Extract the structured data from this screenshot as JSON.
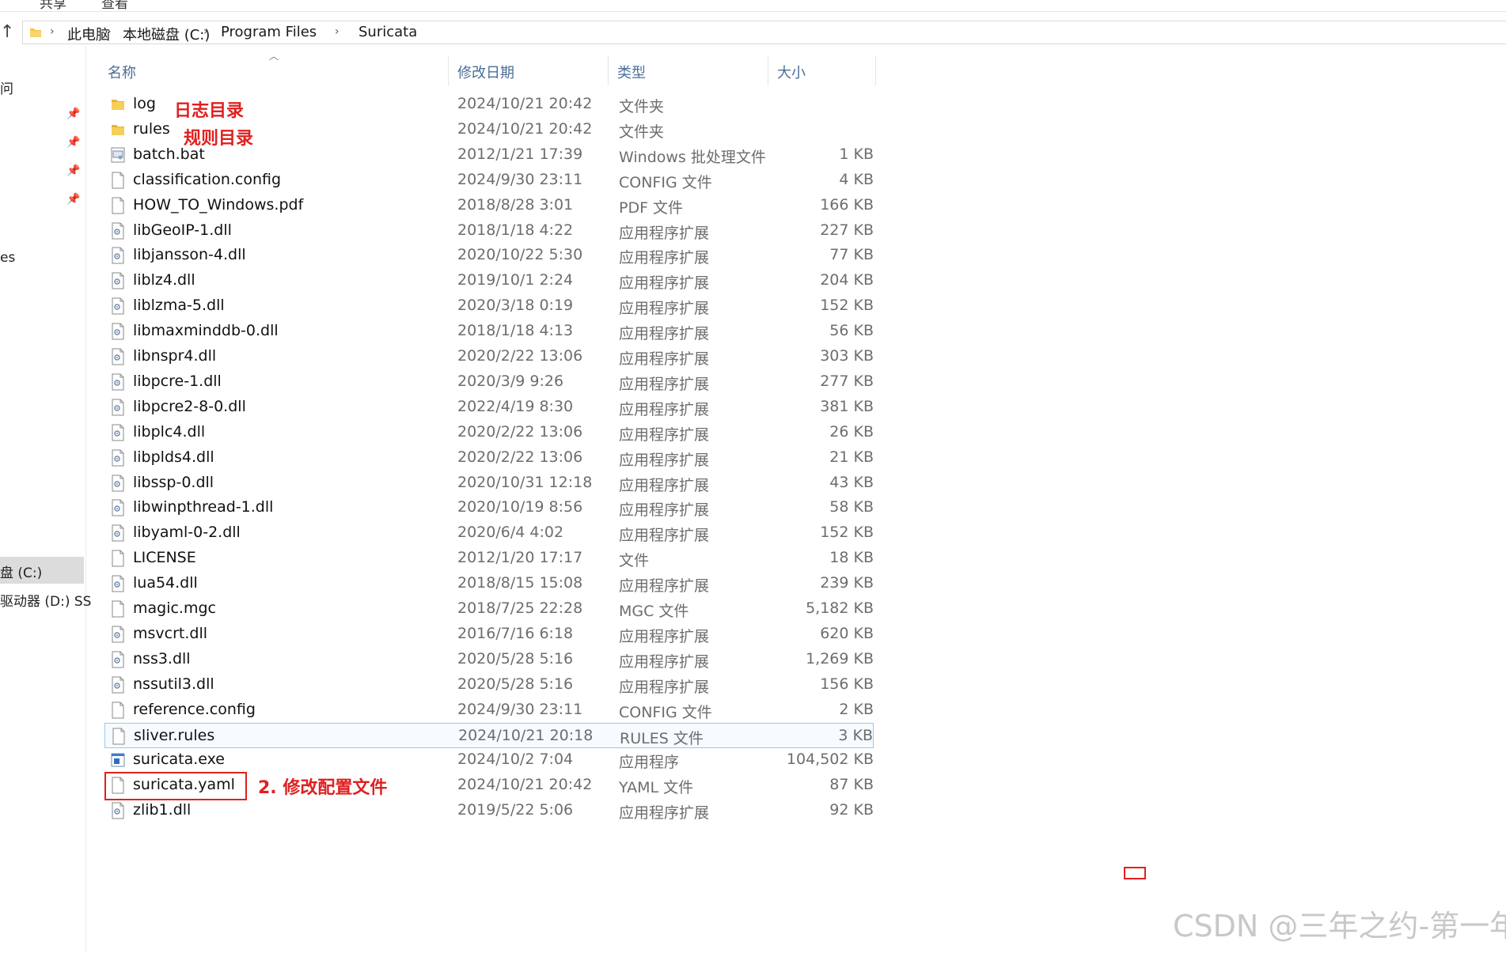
{
  "menu": {
    "items": [
      "共享",
      "查看"
    ]
  },
  "address": {
    "breadcrumbs": [
      "此电脑",
      "本地磁盘 (C:)",
      "Program Files",
      "Suricata"
    ]
  },
  "nav": {
    "partial_labels": [
      "问",
      "es",
      "盘 (C:)",
      "驱动器 (D:) SS"
    ],
    "pinned_count": 4
  },
  "columns": {
    "name": "名称",
    "date": "修改日期",
    "type": "类型",
    "size": "大小"
  },
  "files": [
    {
      "name": "log",
      "date": "2024/10/21 20:42",
      "type": "文件夹",
      "size": "",
      "icon": "folder-icon"
    },
    {
      "name": "rules",
      "date": "2024/10/21 20:42",
      "type": "文件夹",
      "size": "",
      "icon": "folder-icon"
    },
    {
      "name": "batch.bat",
      "date": "2012/1/21 17:39",
      "type": "Windows 批处理文件",
      "size": "1 KB",
      "icon": "batch-file-icon"
    },
    {
      "name": "classification.config",
      "date": "2024/9/30 23:11",
      "type": "CONFIG 文件",
      "size": "4 KB",
      "icon": "file-icon"
    },
    {
      "name": "HOW_TO_Windows.pdf",
      "date": "2018/8/28 3:01",
      "type": "PDF 文件",
      "size": "166 KB",
      "icon": "file-icon"
    },
    {
      "name": "libGeoIP-1.dll",
      "date": "2018/1/18 4:22",
      "type": "应用程序扩展",
      "size": "227 KB",
      "icon": "dll-icon"
    },
    {
      "name": "libjansson-4.dll",
      "date": "2020/10/22 5:30",
      "type": "应用程序扩展",
      "size": "77 KB",
      "icon": "dll-icon"
    },
    {
      "name": "liblz4.dll",
      "date": "2019/10/1 2:24",
      "type": "应用程序扩展",
      "size": "204 KB",
      "icon": "dll-icon"
    },
    {
      "name": "liblzma-5.dll",
      "date": "2020/3/18 0:19",
      "type": "应用程序扩展",
      "size": "152 KB",
      "icon": "dll-icon"
    },
    {
      "name": "libmaxminddb-0.dll",
      "date": "2018/1/18 4:13",
      "type": "应用程序扩展",
      "size": "56 KB",
      "icon": "dll-icon"
    },
    {
      "name": "libnspr4.dll",
      "date": "2020/2/22 13:06",
      "type": "应用程序扩展",
      "size": "303 KB",
      "icon": "dll-icon"
    },
    {
      "name": "libpcre-1.dll",
      "date": "2020/3/9 9:26",
      "type": "应用程序扩展",
      "size": "277 KB",
      "icon": "dll-icon"
    },
    {
      "name": "libpcre2-8-0.dll",
      "date": "2022/4/19 8:30",
      "type": "应用程序扩展",
      "size": "381 KB",
      "icon": "dll-icon"
    },
    {
      "name": "libplc4.dll",
      "date": "2020/2/22 13:06",
      "type": "应用程序扩展",
      "size": "26 KB",
      "icon": "dll-icon"
    },
    {
      "name": "libplds4.dll",
      "date": "2020/2/22 13:06",
      "type": "应用程序扩展",
      "size": "21 KB",
      "icon": "dll-icon"
    },
    {
      "name": "libssp-0.dll",
      "date": "2020/10/31 12:18",
      "type": "应用程序扩展",
      "size": "43 KB",
      "icon": "dll-icon"
    },
    {
      "name": "libwinpthread-1.dll",
      "date": "2020/10/19 8:56",
      "type": "应用程序扩展",
      "size": "58 KB",
      "icon": "dll-icon"
    },
    {
      "name": "libyaml-0-2.dll",
      "date": "2020/6/4 4:02",
      "type": "应用程序扩展",
      "size": "152 KB",
      "icon": "dll-icon"
    },
    {
      "name": "LICENSE",
      "date": "2012/1/20 17:17",
      "type": "文件",
      "size": "18 KB",
      "icon": "file-icon"
    },
    {
      "name": "lua54.dll",
      "date": "2018/8/15 15:08",
      "type": "应用程序扩展",
      "size": "239 KB",
      "icon": "dll-icon"
    },
    {
      "name": "magic.mgc",
      "date": "2018/7/25 22:28",
      "type": "MGC 文件",
      "size": "5,182 KB",
      "icon": "file-icon"
    },
    {
      "name": "msvcrt.dll",
      "date": "2016/7/16 6:18",
      "type": "应用程序扩展",
      "size": "620 KB",
      "icon": "dll-icon"
    },
    {
      "name": "nss3.dll",
      "date": "2020/5/28 5:16",
      "type": "应用程序扩展",
      "size": "1,269 KB",
      "icon": "dll-icon"
    },
    {
      "name": "nssutil3.dll",
      "date": "2020/5/28 5:16",
      "type": "应用程序扩展",
      "size": "156 KB",
      "icon": "dll-icon"
    },
    {
      "name": "reference.config",
      "date": "2024/9/30 23:11",
      "type": "CONFIG 文件",
      "size": "2 KB",
      "icon": "file-icon"
    },
    {
      "name": "sliver.rules",
      "date": "2024/10/21 20:18",
      "type": "RULES 文件",
      "size": "3 KB",
      "icon": "file-icon",
      "hovered": true
    },
    {
      "name": "suricata.exe",
      "date": "2024/10/2 7:04",
      "type": "应用程序",
      "size": "104,502 KB",
      "icon": "exe-icon"
    },
    {
      "name": "suricata.yaml",
      "date": "2024/10/21 20:42",
      "type": "YAML 文件",
      "size": "87 KB",
      "icon": "file-icon"
    },
    {
      "name": "zlib1.dll",
      "date": "2019/5/22 5:06",
      "type": "应用程序扩展",
      "size": "92 KB",
      "icon": "dll-icon"
    }
  ],
  "annotations": {
    "log": "日志目录",
    "rules": "规则目录",
    "config": "2. 修改配置文件"
  },
  "watermark": "CSDN @三年之约-第一年",
  "colors": {
    "annotation": "#e02020",
    "hover_border": "#99c9ef",
    "header_text": "#4b6f96",
    "folder": "#f3c34a"
  }
}
